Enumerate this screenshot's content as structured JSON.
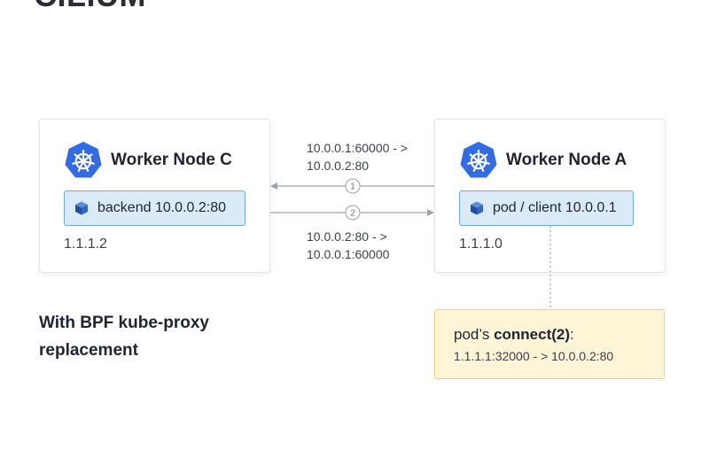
{
  "heading": "CILIUM",
  "nodes": {
    "node_c": {
      "title": "Worker Node C",
      "pod": "backend 10.0.0.2:80",
      "ip": "1.1.1.2"
    },
    "node_a": {
      "title": "Worker Node A",
      "pod": "pod / client 10.0.0.1",
      "ip": "1.1.1.0"
    }
  },
  "flows": [
    {
      "step": "1",
      "line1": "10.0.0.1:60000 - >",
      "line2": "10.0.0.2:80"
    },
    {
      "step": "2",
      "line1": "10.0.0.2:80 - >",
      "line2": "10.0.0.1:60000"
    }
  ],
  "caption": {
    "line1": "With BPF kube-proxy",
    "line2": "replacement"
  },
  "note": {
    "prefix": "pod’s ",
    "emphasis": "connect(2)",
    "suffix": ":",
    "mapping": "1.1.1.1:32000 - > 10.0.0.2:80"
  },
  "colors": {
    "k8s_blue": "#326ce5",
    "pod_fill": "#dbeaf8",
    "pod_border": "#6fa8dc",
    "note_fill": "#fdf5d6",
    "note_border": "#ecd27a",
    "arrow": "#9ca3af"
  },
  "icons": [
    "kubernetes-helm-icon",
    "cube-icon"
  ]
}
